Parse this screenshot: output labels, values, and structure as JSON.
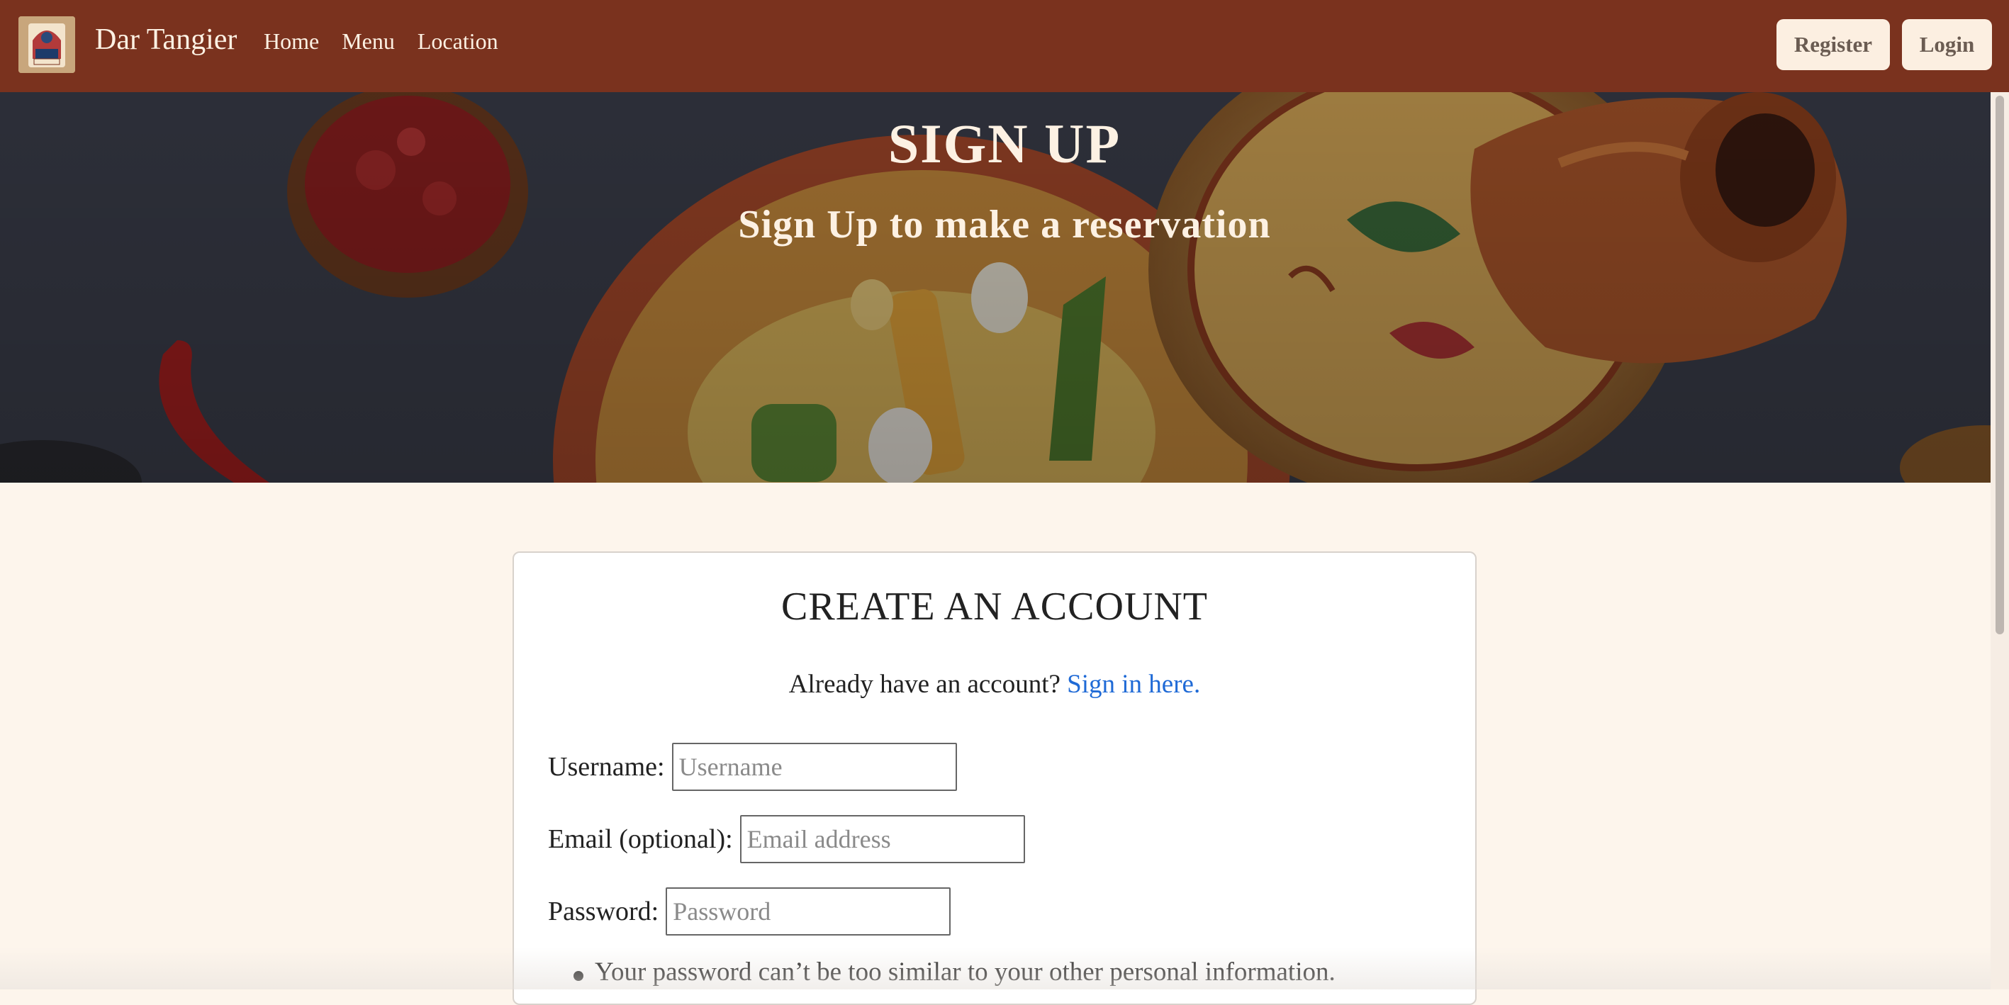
{
  "navbar": {
    "brand_name": "Dar Tangier",
    "logo_icon": "restaurant-logo-icon",
    "links": [
      {
        "label": "Home"
      },
      {
        "label": "Menu"
      },
      {
        "label": "Location"
      }
    ],
    "register_label": "Register",
    "login_label": "Login",
    "colors": {
      "background": "#7a321e",
      "button_bg": "#fcefe1"
    }
  },
  "hero": {
    "title": "SIGN UP",
    "subtitle": "Sign Up to make a reservation"
  },
  "form": {
    "title": "CREATE AN ACCOUNT",
    "signin_prompt": "Already have an account?",
    "signin_link": "Sign in here.",
    "fields": {
      "username": {
        "label": "Username:",
        "placeholder": "Username",
        "value": ""
      },
      "email": {
        "label": "Email (optional):",
        "placeholder": "Email address",
        "value": ""
      },
      "password": {
        "label": "Password:",
        "placeholder": "Password",
        "value": ""
      }
    },
    "password_rules": [
      "Your password can’t be too similar to your other personal information."
    ],
    "colors": {
      "link": "#1f6ad6",
      "page_bg": "#fdf5ec"
    }
  }
}
